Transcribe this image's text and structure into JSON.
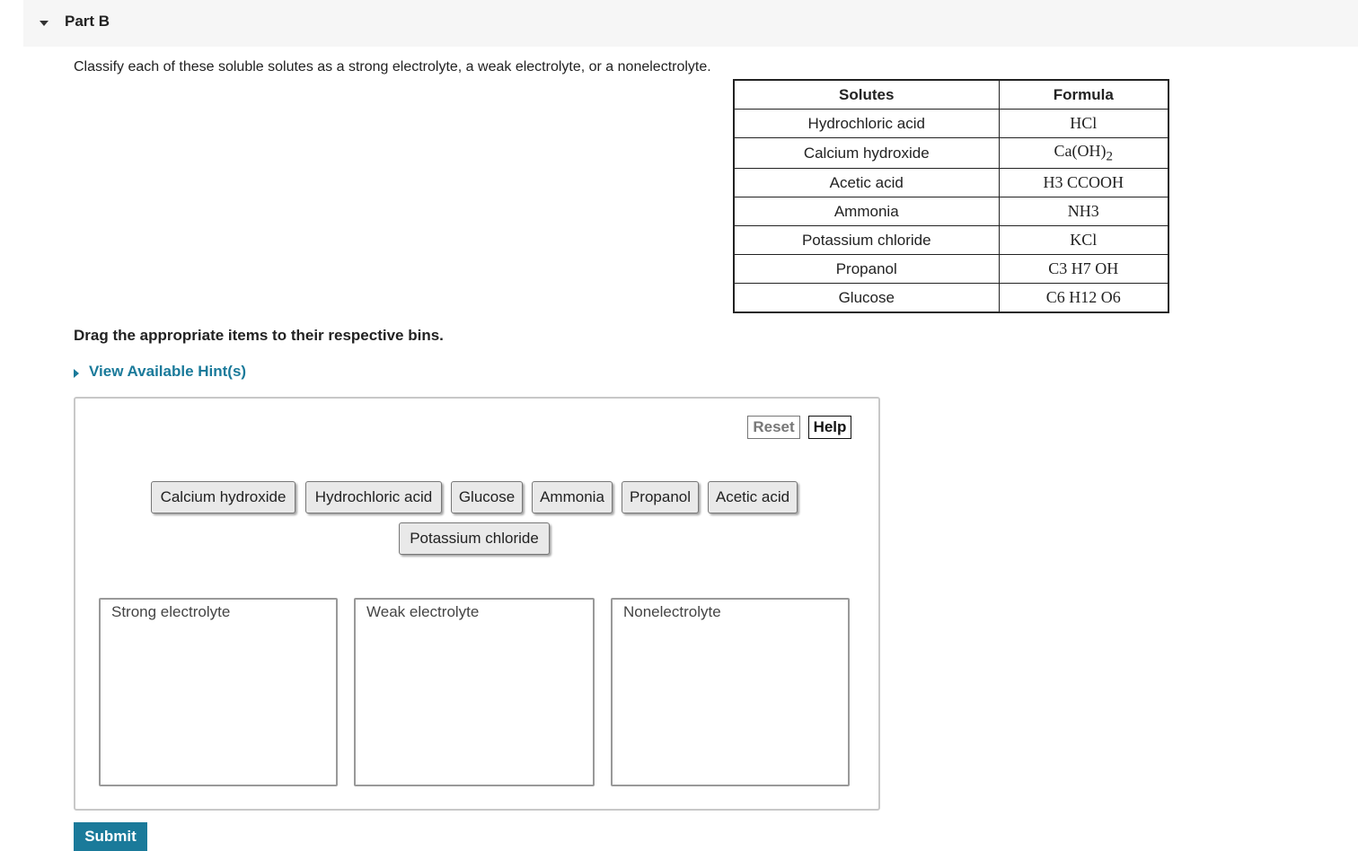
{
  "part": {
    "title": "Part B"
  },
  "instruction": "Classify each of these soluble solutes as a strong electrolyte, a weak electrolyte, or a nonelectrolyte.",
  "table": {
    "headers": [
      "Solutes",
      "Formula"
    ],
    "rows": [
      {
        "solute": "Hydrochloric acid",
        "formula": "HCl"
      },
      {
        "solute": "Calcium hydroxide",
        "formula": "Ca(OH)",
        "sub": "2"
      },
      {
        "solute": "Acetic acid",
        "formula": "H3 CCOOH"
      },
      {
        "solute": "Ammonia",
        "formula": "NH3"
      },
      {
        "solute": "Potassium chloride",
        "formula": "KCl"
      },
      {
        "solute": "Propanol",
        "formula": "C3 H7 OH"
      },
      {
        "solute": "Glucose",
        "formula": "C6 H12 O6"
      }
    ]
  },
  "drag_instruction": "Drag the appropriate items to their respective bins.",
  "hint_link": "View Available Hint(s)",
  "tools": {
    "reset": "Reset",
    "help": "Help"
  },
  "chips": [
    "Calcium hydroxide",
    "Hydrochloric acid",
    "Glucose",
    "Ammonia",
    "Propanol",
    "Acetic acid",
    "Potassium chloride"
  ],
  "bins": [
    "Strong electrolyte",
    "Weak electrolyte",
    "Nonelectrolyte"
  ],
  "submit": "Submit",
  "colors": {
    "accent": "#1a7a9a"
  }
}
